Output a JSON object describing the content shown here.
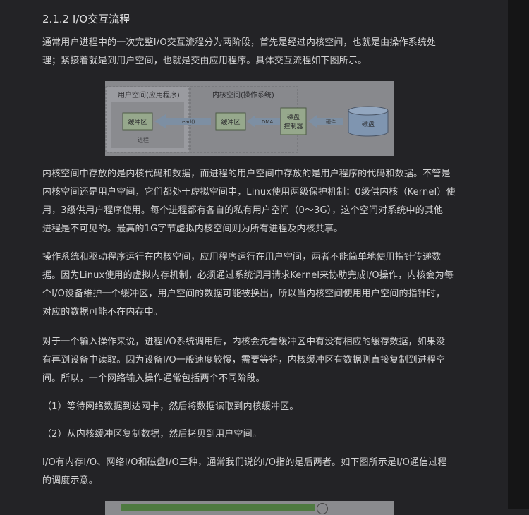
{
  "heading": "2.1.2 I/O交互流程",
  "paragraphs": [
    [
      "通常用户进程中的一次完整I/O交互流程分为两阶段，首先是经过内核空间，也就是由操作系统处",
      "理；紧接着就是到用户空间，也就是交由应用程序。具体交互流程如下图所示。"
    ],
    [
      "内核空间中存放的是内核代码和数据，而进程的用户空间中存放的是用户程序的代码和数据。不管是",
      "内核空间还是用户空间，它们都处于虚拟空间中，Linux使用两级保护机制：0级供内核（Kernel）使",
      "用，3级供用户程序使用。每个进程都有各自的私有用户空间（0～3G），这个空间对系统中的其他",
      "进程是不可见的。最高的1G字节虚拟内核空间则为所有进程及内核共享。"
    ],
    [
      "操作系统和驱动程序运行在内核空间，应用程序运行在用户空间，两者不能简单地使用指针传递数",
      "据。因为Linux使用的虚拟内存机制，必须通过系统调用请求Kernel来协助完成I/O操作，内核会为每",
      "个I/O设备维护一个缓冲区，用户空间的数据可能被换出，所以当内核空间使用用户空间的指针时，",
      "对应的数据可能不在内存中。"
    ],
    [
      "对于一个输入操作来说，进程I/O系统调用后，内核会先看缓冲区中有没有相应的缓存数据，如果没",
      "有再到设备中读取。因为设备I/O一般速度较慢，需要等待，内核缓冲区有数据则直接复制到进程空",
      "间。所以，一个网络输入操作通常包括两个不同阶段。"
    ],
    [
      "（1）等待网络数据到达网卡，然后将数据读取到内核缓冲区。"
    ],
    [
      "（2）从内核缓冲区复制数据，然后拷贝到用户空间。"
    ],
    [
      "I/O有内存I/O、网络I/O和磁盘I/O三种，通常我们说的I/O指的是后两者。如下图所示是I/O通信过程",
      "的调度示意。"
    ]
  ],
  "figure": {
    "user_space_label": "用户空间(应用程序)",
    "kernel_space_label": "内核空间(操作系统)",
    "user_buffer": "缓冲区",
    "process_label": "进程",
    "read_label": "read()",
    "kernel_buffer": "缓冲区",
    "dma_label": "DMA",
    "controller_line1": "磁盘",
    "controller_line2": "控制器",
    "hardware_label": "硬件",
    "disk_label": "磁盘"
  }
}
